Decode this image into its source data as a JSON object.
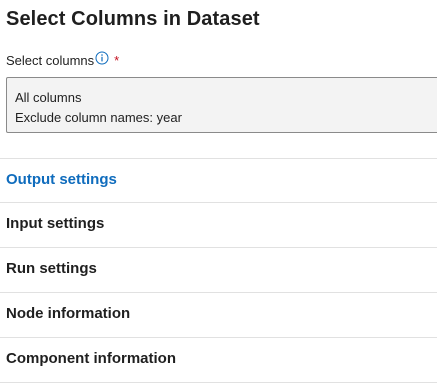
{
  "panel": {
    "title": "Select Columns in Dataset"
  },
  "select_columns": {
    "label": "Select columns",
    "required_mark": "*",
    "info_icon": "info-circle-icon",
    "value_lines": [
      "All columns",
      "Exclude column names: year"
    ]
  },
  "sections": [
    {
      "label": "Output settings",
      "active": true
    },
    {
      "label": "Input settings",
      "active": false
    },
    {
      "label": "Run settings",
      "active": false
    },
    {
      "label": "Node information",
      "active": false
    },
    {
      "label": "Component information",
      "active": false
    }
  ],
  "colors": {
    "accent": "#0f6cbd",
    "required": "#c50f1f",
    "box_background": "#f3f3f3",
    "divider": "#e1e1e1"
  }
}
